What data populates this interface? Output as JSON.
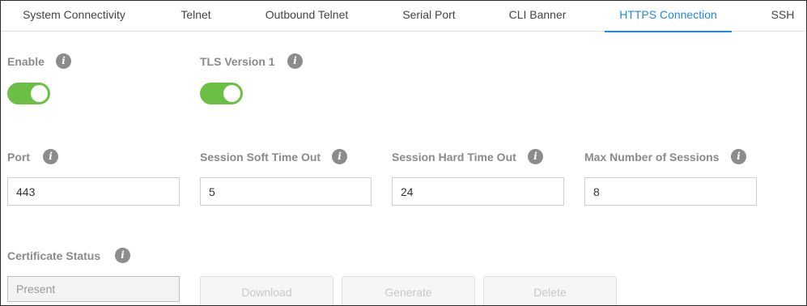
{
  "tabs": [
    {
      "label": "System Connectivity",
      "active": false
    },
    {
      "label": "Telnet",
      "active": false
    },
    {
      "label": "Outbound Telnet",
      "active": false
    },
    {
      "label": "Serial Port",
      "active": false
    },
    {
      "label": "CLI Banner",
      "active": false
    },
    {
      "label": "HTTPS Connection",
      "active": true
    },
    {
      "label": "SSH",
      "active": false
    }
  ],
  "info_glyph": "i",
  "enable": {
    "label": "Enable",
    "on": true
  },
  "tls_version_1": {
    "label": "TLS Version 1",
    "on": true
  },
  "port": {
    "label": "Port",
    "value": "443"
  },
  "session_soft_timeout": {
    "label": "Session Soft Time Out",
    "value": "5"
  },
  "session_hard_timeout": {
    "label": "Session Hard Time Out",
    "value": "24"
  },
  "max_sessions": {
    "label": "Max Number of Sessions",
    "value": "8"
  },
  "certificate_status": {
    "label": "Certificate Status",
    "value": "Present"
  },
  "buttons": {
    "download": "Download",
    "generate": "Generate",
    "delete": "Delete"
  },
  "colors": {
    "accent": "#1e88e5",
    "toggle_on": "#6cbf45",
    "label": "#8a8a8a",
    "info_icon": "#8c8c8c"
  }
}
